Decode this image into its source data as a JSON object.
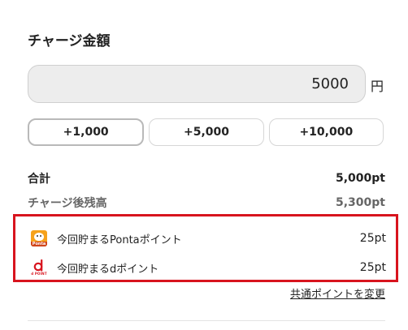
{
  "charge": {
    "title": "チャージ金額",
    "amount": "5000",
    "unit": "円",
    "presets": [
      {
        "label": "+1,000"
      },
      {
        "label": "+5,000"
      },
      {
        "label": "+10,000"
      }
    ]
  },
  "summary": {
    "total_label": "合計",
    "total_value": "5,000pt",
    "remaining_label": "チャージ後残高",
    "remaining_value": "5,300pt"
  },
  "points": {
    "ponta": {
      "label": "今回貯まるPontaポイント",
      "value": "25pt",
      "logo_text": "Ponta",
      "icon": "ponta-logo-icon"
    },
    "dpoint": {
      "label": "今回貯まるdポイント",
      "value": "25pt",
      "logo_text": "d POINT",
      "icon": "dpoint-logo-icon"
    },
    "change_link": "共通ポイントを変更"
  },
  "colors": {
    "highlight_border": "#d8141e",
    "ponta_orange": "#f6a21b",
    "dpoint_red": "#d8141e"
  }
}
